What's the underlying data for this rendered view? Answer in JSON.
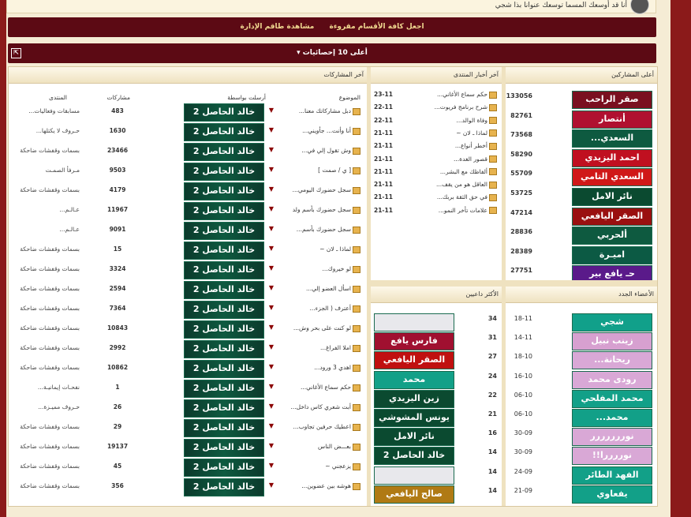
{
  "topbar": {
    "greeting": "أنا قد أوسعك المسما توسعك عنوانا بذا شجي"
  },
  "links": {
    "mark_read": "اجعل كافة الأقسام مقروءة",
    "view_staff": "مشاهدة طاقم الإدارة"
  },
  "stats_bar": {
    "title": "أعلى 10 إحصائيات"
  },
  "top_posters": {
    "title": "أعلى المشاركين",
    "items": [
      {
        "name": "صقر الراحب",
        "count": "133056",
        "bg": "#7a1020"
      },
      {
        "name": "أنتصار",
        "count": "82761",
        "bg": "#b01030"
      },
      {
        "name": "السعدي...",
        "count": "73568",
        "bg": "#0e5a40"
      },
      {
        "name": "احمد اليزيدي",
        "count": "58290",
        "bg": "#c01020"
      },
      {
        "name": "السعدي التامي",
        "count": "55709",
        "bg": "#d01818"
      },
      {
        "name": "نائر الامل",
        "count": "53725",
        "bg": "#0b4a30"
      },
      {
        "name": "الصقر اليافعي",
        "count": "47214",
        "bg": "#9a1010"
      },
      {
        "name": "ألحربي",
        "count": "28836",
        "bg": "#0e5a40"
      },
      {
        "name": "اميـرة",
        "count": "28389",
        "bg": "#0c5a44"
      },
      {
        "name": "حـ يافع بير",
        "count": "27751",
        "bg": "#5a1a8a"
      }
    ]
  },
  "new_members": {
    "title": "الأعضاء الجدد",
    "items": [
      {
        "name": "شجي",
        "date": "18-11",
        "bg": "#11a08a"
      },
      {
        "name": "زينب نبيل",
        "date": "14-11",
        "bg": "#d7a0d0"
      },
      {
        "name": "ريحانة...",
        "date": "18-10",
        "bg": "#d9a8d6"
      },
      {
        "name": "رودى محمد",
        "date": "16-10",
        "bg": "#d9a8d6"
      },
      {
        "name": "محمد المفلحي",
        "date": "06-10",
        "bg": "#12a088"
      },
      {
        "name": "محمد...",
        "date": "06-10",
        "bg": "#12a088"
      },
      {
        "name": "نوررررررر",
        "date": "30-09",
        "bg": "#d9a8d6"
      },
      {
        "name": "نوررررا!!",
        "date": "30-09",
        "bg": "#d9a8d6"
      },
      {
        "name": "الفهد الطائر",
        "date": "24-09",
        "bg": "#12a088"
      },
      {
        "name": "يفعاوي",
        "date": "21-09",
        "bg": "#12a088"
      }
    ]
  },
  "forum_news": {
    "title": "آخر أخبار المنتدى",
    "items": [
      {
        "title": "حكم سماع الأغاني...",
        "date": "23-11"
      },
      {
        "title": "شرح برنامج فريوت...",
        "date": "22-11"
      },
      {
        "title": "وفاة الوالد...",
        "date": "22-11"
      },
      {
        "title": "لماذا ـ لان ~",
        "date": "21-11"
      },
      {
        "title": "أخطر أنواع...",
        "date": "21-11"
      },
      {
        "title": "قصور الغدة...",
        "date": "21-11"
      },
      {
        "title": "ألفاظك مع البشر...",
        "date": "21-11"
      },
      {
        "title": "العاقل هو من يقف...",
        "date": "21-11"
      },
      {
        "title": "في حق الثقة بربك...",
        "date": "21-11"
      },
      {
        "title": "علامات تأخر النمو...",
        "date": "21-11"
      }
    ]
  },
  "most_invites": {
    "title": "الأكثر داعيين",
    "items": [
      {
        "name": "",
        "count": "34",
        "bg": "#e8e8ec"
      },
      {
        "name": "فارس يافع",
        "count": "31",
        "bg": "#a01030"
      },
      {
        "name": "الصقر اليافعي",
        "count": "27",
        "bg": "#c01010"
      },
      {
        "name": "محمد",
        "count": "24",
        "bg": "#12a088"
      },
      {
        "name": "زين اليزيدي",
        "count": "22",
        "bg": "#0b4a30"
      },
      {
        "name": "يونس المشوشي",
        "count": "21",
        "bg": "#0b4a30"
      },
      {
        "name": "نائر الامل",
        "count": "16",
        "bg": "#0b4a30"
      },
      {
        "name": "خالد الحاصل 2",
        "count": "14",
        "bg": "#0b4a30"
      },
      {
        "name": "",
        "count": "14",
        "bg": "#e8e8ec"
      },
      {
        "name": "صالح اليافعي",
        "count": "14",
        "bg": "#b07a14"
      }
    ]
  },
  "last_posts": {
    "title": "آخر المشاركات",
    "col_topic": "الموضوع",
    "col_author": "أرسلت بواسطة",
    "col_count": "مشاركات",
    "col_forum": "المنتدى",
    "rows": [
      {
        "topic": "دبل مشاركاتك معنا...",
        "author": "خالد الحاصل 2",
        "count": "483",
        "forum": "مسابقات وفعاليات..."
      },
      {
        "topic": "أنا وأنت... جأويني...",
        "author": "خالد الحاصل 2",
        "count": "1630",
        "forum": "حـروف لا يكتلها..."
      },
      {
        "topic": "وش تقول إلي في...",
        "author": "خالد الحاصل 2",
        "count": "23466",
        "forum": "بسمات وقفشات ضاحكة"
      },
      {
        "topic": "[ ي / صمت ]",
        "author": "خالد الحاصل 2",
        "count": "9503",
        "forum": "مـرفأ الصمـت"
      },
      {
        "topic": "سجل حضورك اليومي...",
        "author": "خالد الحاصل 2",
        "count": "4179",
        "forum": "بسمات وقفشات ضاحكة"
      },
      {
        "topic": "سجل حضورك بأسم ولد",
        "author": "خالد الحاصل 2",
        "count": "11967",
        "forum": "عـالـم..."
      },
      {
        "topic": "سجل حضورك بأسم...",
        "author": "خالد الحاصل 2",
        "count": "9091",
        "forum": "عـالـم..."
      },
      {
        "topic": "لماذا ـ لان ~",
        "author": "خالد الحاصل 2",
        "count": "15",
        "forum": "بسمات وقفشات ضاحكة"
      },
      {
        "topic": "لو خيروك...",
        "author": "خالد الحاصل 2",
        "count": "3324",
        "forum": "بسمات وقفشات ضاحكة"
      },
      {
        "topic": "اسأل العضو إلي...",
        "author": "خالد الحاصل 2",
        "count": "2594",
        "forum": "بسمات وقفشات ضاحكة"
      },
      {
        "topic": "أعترف ( الجزء...",
        "author": "خالد الحاصل 2",
        "count": "7364",
        "forum": "بسمات وقفشات ضاحكة"
      },
      {
        "topic": "لو كنت على بحر وش...",
        "author": "خالد الحاصل 2",
        "count": "10843",
        "forum": "بسمات وقفشات ضاحكة"
      },
      {
        "topic": "املا الفراغ...",
        "author": "خالد الحاصل 2",
        "count": "2992",
        "forum": "بسمات وقفشات ضاحكة"
      },
      {
        "topic": "اهدي 3 ورود...",
        "author": "خالد الحاصل 2",
        "count": "10862",
        "forum": "بسمات وقفشات ضاحكة"
      },
      {
        "topic": "حكم سماع الأغاني...",
        "author": "خالد الحاصل 2",
        "count": "1",
        "forum": "نفحـات إيمانيـة..."
      },
      {
        "topic": "أبت شعري كاس داخل...",
        "author": "خالد الحاصل 2",
        "count": "26",
        "forum": "حـروف مميـزة..."
      },
      {
        "topic": "اعطيك حرفين تجاوب...",
        "author": "خالد الحاصل 2",
        "count": "29",
        "forum": "بسمات وقفشات ضاحكة"
      },
      {
        "topic": "بعـــض الناس",
        "author": "خالد الحاصل 2",
        "count": "19137",
        "forum": "بسمات وقفشات ضاحكة"
      },
      {
        "topic": "يزعجني ~",
        "author": "خالد الحاصل 2",
        "count": "45",
        "forum": "بسمات وقفشات ضاحكة"
      },
      {
        "topic": "هوشه بين عضوين...",
        "author": "خالد الحاصل 2",
        "count": "356",
        "forum": "بسمات وقفشات ضاحكة"
      }
    ]
  }
}
